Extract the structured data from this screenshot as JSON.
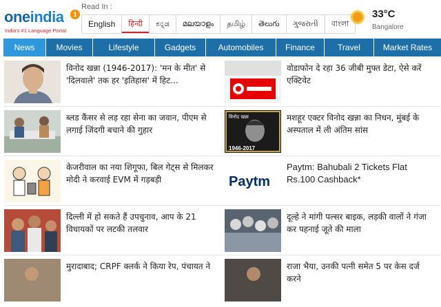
{
  "brand": {
    "logo_one": "one",
    "logo_india": "india",
    "badge": "1",
    "tagline": "India's #1 Language Portal"
  },
  "language_bar": {
    "label": "Read In :",
    "languages": [
      "English",
      "हिन्दी",
      "ಕನ್ನಡ",
      "മലയാളം",
      "தமிழ்",
      "తెలుగు",
      "ગુજરાતી",
      "বাংলা"
    ],
    "active": "हिन्दी"
  },
  "weather": {
    "temperature": "33°C",
    "city": "Bangalore",
    "icon": "sun-icon"
  },
  "nav": {
    "items": [
      "News",
      "Movies",
      "Lifestyle",
      "Gadgets",
      "Automobiles",
      "Finance",
      "Travel",
      "Market Rates"
    ],
    "active": "News"
  },
  "articles": [
    {
      "title": "विनोद खन्ना (1946-2017): 'मन के मीत' से 'दिलवाले' तक हर 'इतिहास' में हिट..."
    },
    {
      "title": "वोडाफोन दे रहा 36 जीबी मुफ्त डेटा, ऐसे करें एक्टिवेट"
    },
    {
      "title": "ब्लड कैंसर से लड़ रहा सेना का जवान, पीएम से लगाई जिंदगी बचाने की गुहार"
    },
    {
      "title": "मशहूर एक्टर विनोद खन्ना का निधन, मुंबई के अस्पताल में ली अंतिम सांस",
      "thumb_caption_1": "विनोद खन्ना",
      "thumb_caption_2": "1946-2017"
    },
    {
      "title": "केजरीवाल का नया शिगूफा, बिल गेट्स से मिलकर मोदी ने करवाई EVM में गड़बड़ी"
    },
    {
      "title": "Paytm: Bahubali 2 Tickets Flat Rs.100 Cashback*",
      "logo_text": "Paytm"
    },
    {
      "title": "दिल्ली में हो सकते हैं उपचुनाव, आप के 21 विधायकों पर लटकी तलवार"
    },
    {
      "title": "दूल्हे ने मांगी पल्सर बाइक, लड़की वालों ने गंजा कर पहनाई जूते की माला"
    },
    {
      "title": "मुरादाबाद; CRPF क्लर्क ने किया रेप, पंचायत ने"
    },
    {
      "title": "राजा भैया, उनकी पत्नी समेत 5 पर केस दर्ज करने"
    }
  ],
  "colors": {
    "nav_bg": "#1e6fa8",
    "nav_active": "#2f98dc",
    "brand_blue": "#1565a8",
    "active_lang": "#c62828",
    "badge": "#f39200"
  }
}
